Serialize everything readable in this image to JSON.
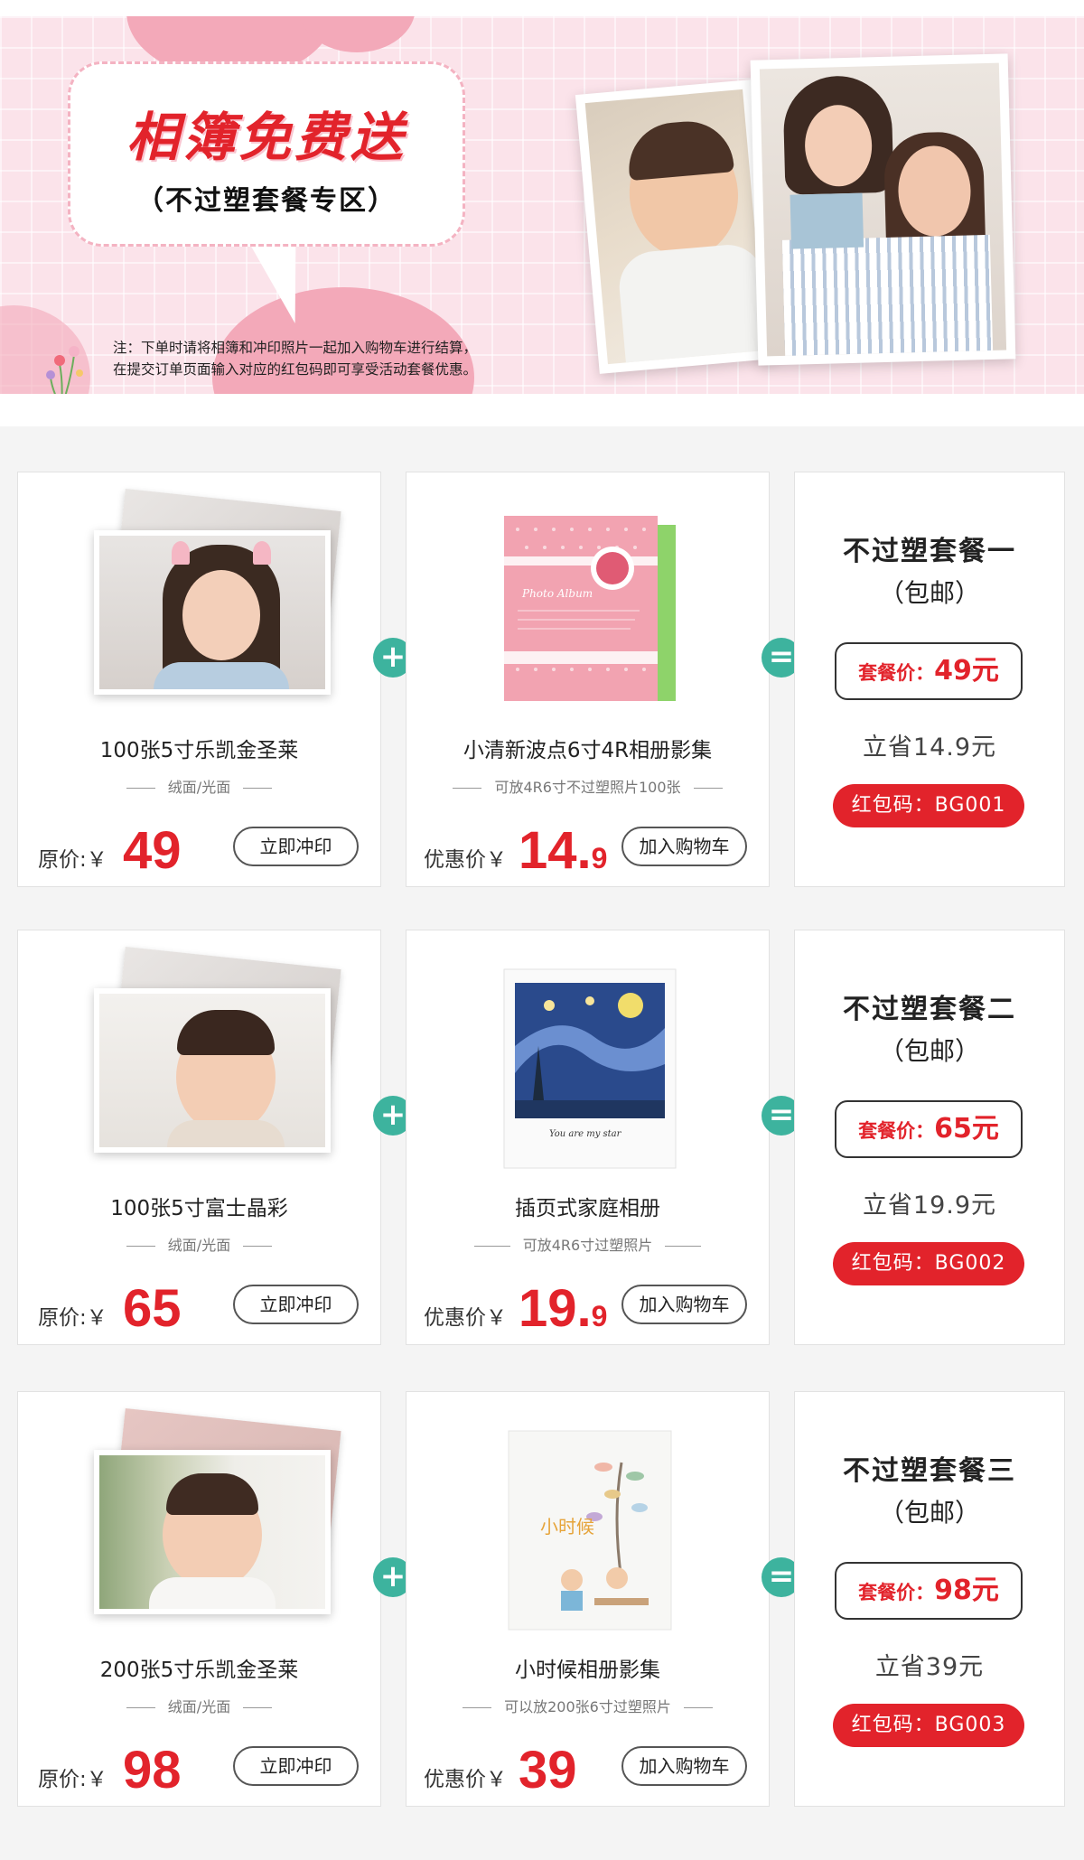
{
  "banner": {
    "title": "相簿免费送",
    "subtitle": "（不过塑套餐专区）",
    "note_line1": "注：下单时请将相簿和冲印照片一起加入购物车进行结算，",
    "note_line2": "在提交订单页面输入对应的红包码即可享受活动套餐优惠。"
  },
  "colors": {
    "accent_red": "#e2232b",
    "operator_green": "#3db39e",
    "banner_pink": "#fbe3ea"
  },
  "operators": {
    "plus": "+",
    "equal": "="
  },
  "bundles": [
    {
      "print": {
        "title": "100张5寸乐凯金圣莱",
        "sub": "绒面/光面",
        "price_label": "原价:￥",
        "price": "49",
        "button": "立即冲印"
      },
      "album": {
        "title": "小清新波点6寸4R相册影集",
        "sub": "可放4R6寸不过塑照片100张",
        "price_label": "优惠价￥",
        "price_int": "14.",
        "price_dec": "9",
        "button": "加入购物车"
      },
      "package": {
        "title": "不过塑套餐一",
        "shipping": "（包邮）",
        "price_label": "套餐价：",
        "price": "49元",
        "save": "立省14.9元",
        "code": "红包码：BG001"
      }
    },
    {
      "print": {
        "title": "100张5寸富士晶彩",
        "sub": "绒面/光面",
        "price_label": "原价:￥",
        "price": "65",
        "button": "立即冲印"
      },
      "album": {
        "title": "插页式家庭相册",
        "sub": "可放4R6寸过塑照片",
        "price_label": "优惠价￥",
        "price_int": "19.",
        "price_dec": "9",
        "button": "加入购物车"
      },
      "package": {
        "title": "不过塑套餐二",
        "shipping": "（包邮）",
        "price_label": "套餐价：",
        "price": "65元",
        "save": "立省19.9元",
        "code": "红包码：BG002"
      }
    },
    {
      "print": {
        "title": "200张5寸乐凯金圣莱",
        "sub": "绒面/光面",
        "price_label": "原价:￥",
        "price": "98",
        "button": "立即冲印"
      },
      "album": {
        "title": "小时候相册影集",
        "sub": "可以放200张6寸过塑照片",
        "price_label": "优惠价￥",
        "price_int": "39",
        "price_dec": "",
        "button": "加入购物车"
      },
      "package": {
        "title": "不过塑套餐三",
        "shipping": "（包邮）",
        "price_label": "套餐价：",
        "price": "98元",
        "save": "立省39元",
        "code": "红包码：BG003"
      }
    }
  ],
  "album_art_text": {
    "pink_album": "Photo Album",
    "starry_album": "You are my star",
    "kid_album": "小时候"
  }
}
